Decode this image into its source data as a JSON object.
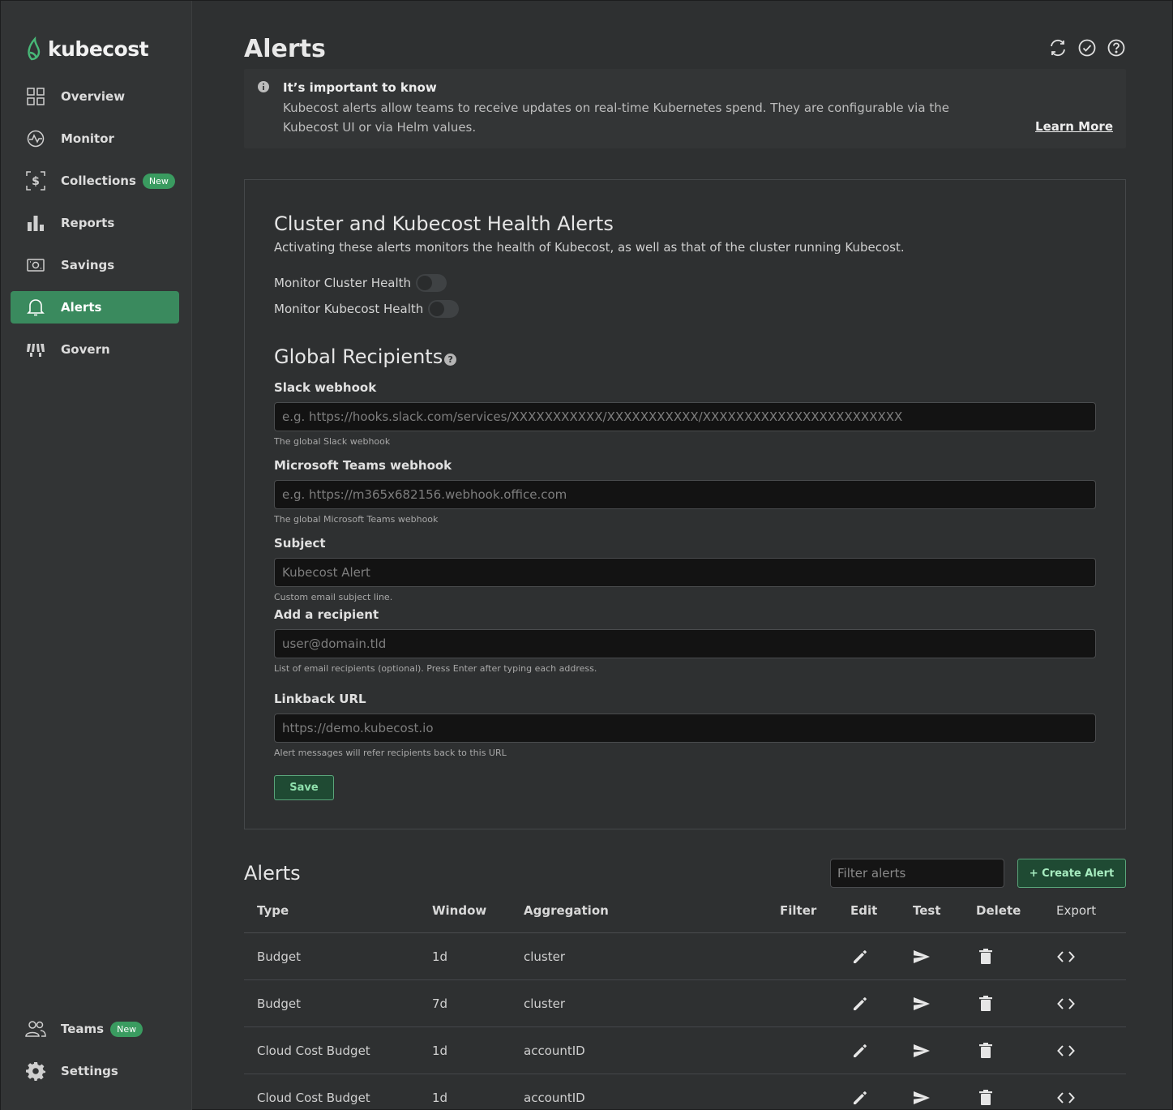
{
  "app": {
    "name": "kubecost"
  },
  "sidebar": {
    "items": [
      {
        "label": "Overview",
        "icon": "grid-icon"
      },
      {
        "label": "Monitor",
        "icon": "pulse-icon"
      },
      {
        "label": "Collections",
        "icon": "dollar-frame-icon",
        "badge": "New"
      },
      {
        "label": "Reports",
        "icon": "bar-chart-icon"
      },
      {
        "label": "Savings",
        "icon": "money-icon"
      },
      {
        "label": "Alerts",
        "icon": "bell-icon",
        "active": true
      },
      {
        "label": "Govern",
        "icon": "govern-icon"
      }
    ],
    "bottom": [
      {
        "label": "Teams",
        "icon": "people-icon",
        "badge": "New"
      },
      {
        "label": "Settings",
        "icon": "gear-icon"
      }
    ]
  },
  "header": {
    "title": "Alerts"
  },
  "info": {
    "title": "It’s important to know",
    "text": "Kubecost alerts allow teams to receive updates on real-time Kubernetes spend. They are configurable via the Kubecost UI or via Helm values.",
    "link": "Learn More"
  },
  "health": {
    "title": "Cluster and Kubecost Health Alerts",
    "description": "Activating these alerts monitors the health of Kubecost, as well as that of the cluster running Kubecost.",
    "toggle_cluster": "Monitor Cluster Health",
    "toggle_kubecost": "Monitor Kubecost Health"
  },
  "recipients": {
    "title": "Global Recipients",
    "help_glyph": "?",
    "slack": {
      "label": "Slack webhook",
      "placeholder": "e.g. https://hooks.slack.com/services/XXXXXXXXXXX/XXXXXXXXXXX/XXXXXXXXXXXXXXXXXXXXXXXX",
      "help": "The global Slack webhook"
    },
    "teams": {
      "label": "Microsoft Teams webhook",
      "placeholder": "e.g. https://m365x682156.webhook.office.com",
      "help": "The global Microsoft Teams webhook"
    },
    "subject": {
      "label": "Subject",
      "placeholder": "Kubecost Alert",
      "help": "Custom email subject line."
    },
    "recipient": {
      "label": "Add a recipient",
      "placeholder": "user@domain.tld",
      "help": "List of email recipients (optional). Press Enter after typing each address."
    },
    "linkback": {
      "label": "Linkback URL",
      "placeholder": "https://demo.kubecost.io",
      "help": "Alert messages will refer recipients back to this URL"
    },
    "save_label": "Save"
  },
  "alerts": {
    "title": "Alerts",
    "filter_placeholder": "Filter alerts",
    "create_label": "+ Create Alert",
    "columns": [
      "Type",
      "Window",
      "Aggregation",
      "Filter",
      "Edit",
      "Test",
      "Delete",
      "Export"
    ],
    "rows": [
      {
        "type": "Budget",
        "window": "1d",
        "aggregation": "cluster"
      },
      {
        "type": "Budget",
        "window": "7d",
        "aggregation": "cluster"
      },
      {
        "type": "Cloud Cost Budget",
        "window": "1d",
        "aggregation": "accountID"
      },
      {
        "type": "Cloud Cost Budget",
        "window": "1d",
        "aggregation": "accountID"
      }
    ]
  },
  "colors": {
    "accent": "#3a8a5e",
    "background": "#2e3031",
    "sidebar": "#323435"
  }
}
